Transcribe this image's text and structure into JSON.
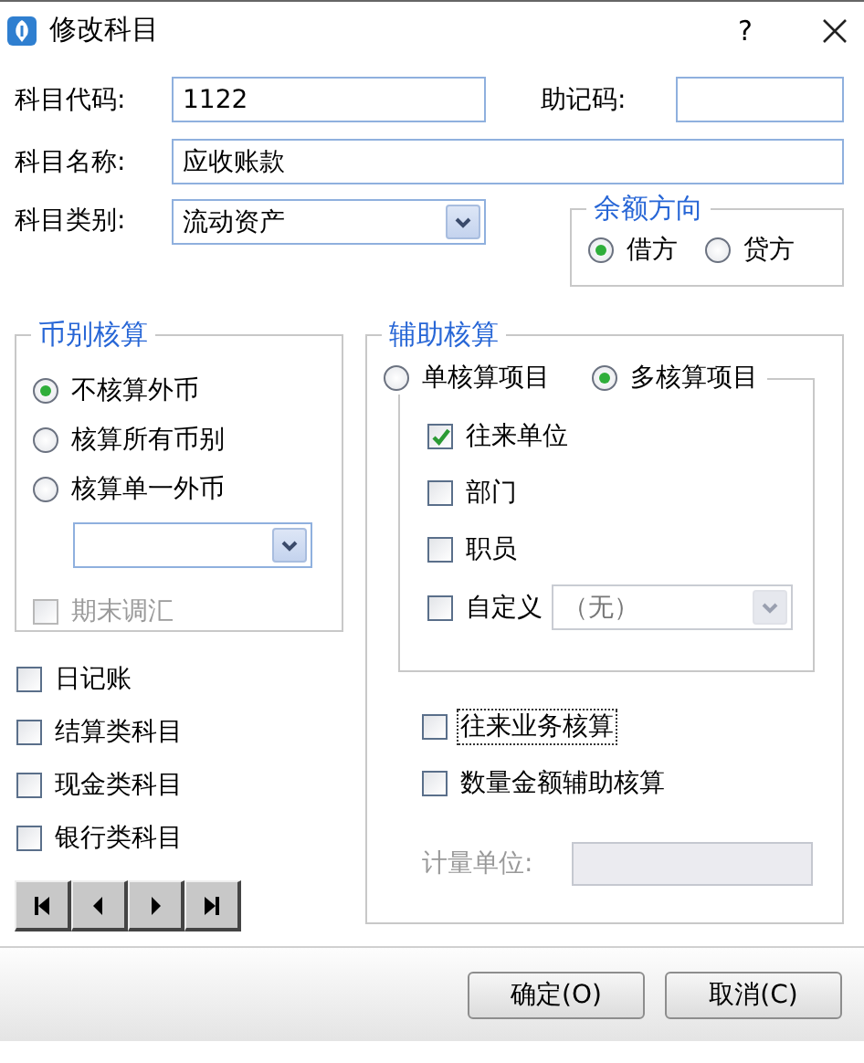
{
  "window": {
    "title": "修改科目",
    "help": "?"
  },
  "code": {
    "label": "科目代码:",
    "value": "1122"
  },
  "mnemonic": {
    "label": "助记码:"
  },
  "name": {
    "label": "科目名称:",
    "value": "应收账款"
  },
  "category": {
    "label": "科目类别:",
    "value": "流动资产"
  },
  "balance_direction": {
    "title": "余额方向",
    "options": [
      {
        "label": "借方",
        "selected": true
      },
      {
        "label": "贷方",
        "selected": false
      }
    ]
  },
  "currency": {
    "title": "币别核算",
    "options": [
      {
        "label": "不核算外币",
        "selected": true
      },
      {
        "label": "核算所有币别",
        "selected": false
      },
      {
        "label": "核算单一外币",
        "selected": false
      }
    ],
    "period_end_adjust": {
      "label": "期末调汇",
      "checked": false,
      "disabled": true
    }
  },
  "flags": [
    {
      "label": "日记账",
      "checked": false
    },
    {
      "label": "结算类科目",
      "checked": false
    },
    {
      "label": "现金类科目",
      "checked": false
    },
    {
      "label": "银行类科目",
      "checked": false
    }
  ],
  "aux": {
    "title": "辅助核算",
    "modes": [
      {
        "label": "单核算项目",
        "selected": false
      },
      {
        "label": "多核算项目",
        "selected": true
      }
    ],
    "items": [
      {
        "label": "往来单位",
        "checked": true
      },
      {
        "label": "部门",
        "checked": false
      },
      {
        "label": "职员",
        "checked": false
      },
      {
        "label": "自定义",
        "checked": false,
        "combo": "（无）"
      }
    ],
    "options": [
      {
        "label": "往来业务核算",
        "checked": false,
        "focused": true
      },
      {
        "label": "数量金额辅助核算",
        "checked": false,
        "focused": false
      }
    ],
    "unit": {
      "label": "计量单位:",
      "disabled": true
    }
  },
  "buttons": [
    {
      "label": "确定(O)"
    },
    {
      "label": "取消(C)"
    }
  ]
}
